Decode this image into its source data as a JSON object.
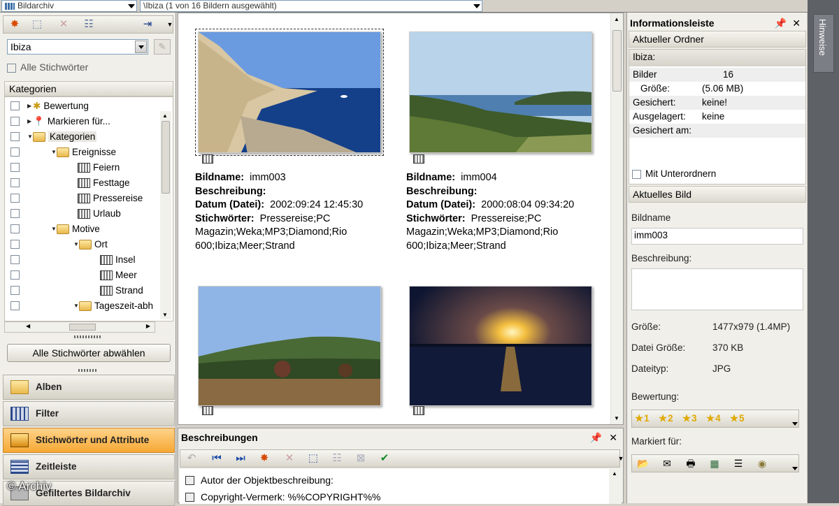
{
  "topbar": {
    "archive_combo": "Bildarchiv",
    "path_combo": "\\Ibiza (1 von 16 Bildern ausgewählt)"
  },
  "left": {
    "keyword_value": "Ibiza",
    "all_keywords_label": "Alle Stichwörter",
    "categories_header": "Kategorien",
    "tree": [
      {
        "label": "Bewertung"
      },
      {
        "label": "Markieren für..."
      },
      {
        "label": "Kategorien"
      },
      {
        "label": "Ereignisse"
      },
      {
        "label": "Feiern"
      },
      {
        "label": "Festtage"
      },
      {
        "label": "Pressereise"
      },
      {
        "label": "Urlaub"
      },
      {
        "label": "Motive"
      },
      {
        "label": "Ort"
      },
      {
        "label": "Insel"
      },
      {
        "label": "Meer"
      },
      {
        "label": "Strand"
      },
      {
        "label": "Tageszeit-abh"
      }
    ],
    "deselect_button": "Alle Stichwörter abwählen",
    "nav": [
      {
        "label": "Alben"
      },
      {
        "label": "Filter"
      },
      {
        "label": "Stichwörter und Attribute"
      },
      {
        "label": "Zeitleiste"
      },
      {
        "label": "Gefiltertes Bildarchiv"
      }
    ]
  },
  "images": [
    {
      "name_label": "Bildname:",
      "name": "imm003",
      "desc_label": "Beschreibung:",
      "date_label": "Datum (Datei):",
      "date": "2002:09:24 12:45:30",
      "kw_label": "Stichwörter:",
      "keywords_1": "Pressereise;PC",
      "keywords_2": "Magazin;Weka;MP3;Diamond;Rio",
      "keywords_3": "600;Ibiza;Meer;Strand"
    },
    {
      "name_label": "Bildname:",
      "name": "imm004",
      "desc_label": "Beschreibung:",
      "date_label": "Datum (Datei):",
      "date": "2000:08:04 09:34:20",
      "kw_label": "Stichwörter:",
      "keywords_1": "Pressereise;PC",
      "keywords_2": "Magazin;Weka;MP3;Diamond;Rio",
      "keywords_3": "600;Ibiza;Meer;Strand"
    }
  ],
  "descriptions": {
    "title": "Beschreibungen",
    "lines": [
      {
        "text": "Autor der Objektbeschreibung:"
      },
      {
        "text": "Copyright-Vermerk:  %%COPYRIGHT%%"
      }
    ]
  },
  "info": {
    "title": "Informationsleiste",
    "current_folder": "Aktueller Ordner",
    "folder_name": "Ibiza:",
    "rows": [
      {
        "k": "Bilder",
        "v": "16"
      },
      {
        "k": "Größe:",
        "v": "(5.06 MB)"
      },
      {
        "k": "Gesichert:",
        "v": "keine!"
      },
      {
        "k": "Ausgelagert:",
        "v": "keine"
      },
      {
        "k": "Gesichert am:",
        "v": ""
      }
    ],
    "subfolders_label": "Mit Unterordnern",
    "current_image": "Aktuelles Bild",
    "bildname_label": "Bildname",
    "bildname_value": "imm003",
    "beschreibung_label": "Beschreibung:",
    "size_label": "Größe:",
    "size_value": "1477x979 (1.4MP)",
    "filesize_label": "Datei Größe:",
    "filesize_value": "370 KB",
    "filetype_label": "Dateityp:",
    "filetype_value": "JPG",
    "rating_label": "Bewertung:",
    "stars": [
      "1",
      "2",
      "3",
      "4",
      "5"
    ],
    "marked_label": "Markiert für:"
  },
  "strip": {
    "tab": "Hinweise"
  },
  "watermark": "© Archiv",
  "colors": {
    "active_nav": "#f6a833",
    "panel": "#f0efe9",
    "strip": "#5e6166"
  }
}
